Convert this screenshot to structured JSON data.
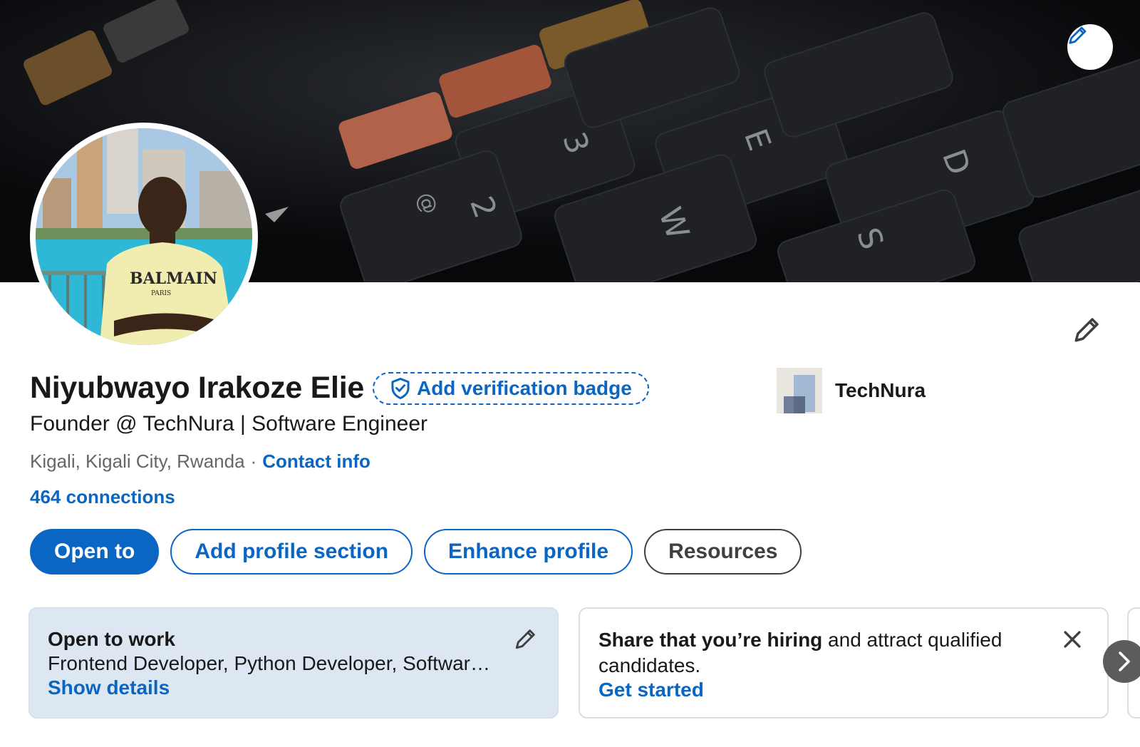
{
  "profile": {
    "name": "Niyubwayo Irakoze Elie",
    "verification_badge_label": "Add verification badge",
    "headline": "Founder @ TechNura | Software Engineer",
    "location": "Kigali, Kigali City, Rwanda",
    "separator": "·",
    "contact_info_label": "Contact info",
    "connections_label": "464 connections",
    "avatar_shirt_text": "BALMAIN",
    "avatar_shirt_subtext": "PARIS"
  },
  "company": {
    "name": "TechNura"
  },
  "actions": {
    "open_to": "Open to",
    "add_profile_section": "Add profile section",
    "enhance_profile": "Enhance profile",
    "resources": "Resources"
  },
  "cards": {
    "open_to_work": {
      "title": "Open to work",
      "roles": "Frontend Developer, Python Developer, Softwar…",
      "link": "Show details"
    },
    "hiring": {
      "bold_text": "Share that you’re hiring",
      "text": " and attract qualified candidates.",
      "link": "Get started"
    }
  },
  "banner": {
    "keys": [
      "3",
      "2",
      "@",
      "W",
      "E",
      "S",
      "D"
    ]
  },
  "icons": {
    "edit_banner": "pencil-icon",
    "edit_intro": "pencil-icon",
    "verify": "shield-check-icon",
    "close": "close-icon",
    "next": "chevron-right-icon"
  },
  "colors": {
    "accent": "#0a66c2",
    "card_bg": "#dde7f1",
    "text": "#191919",
    "muted": "#666666"
  }
}
